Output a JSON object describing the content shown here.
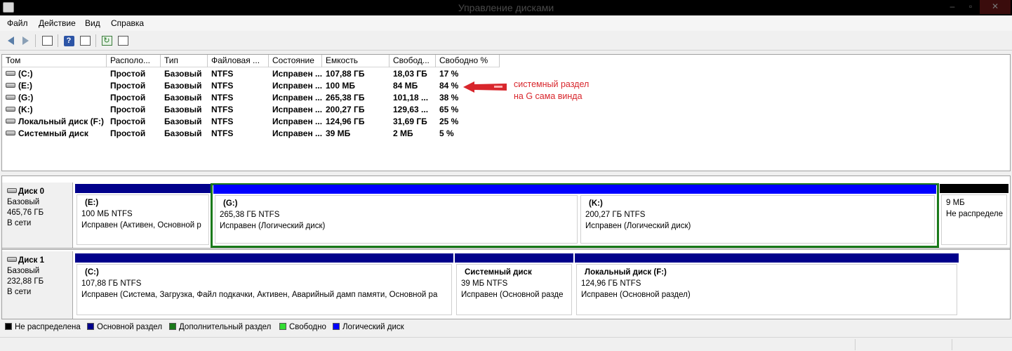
{
  "window": {
    "title": "Управление дисками",
    "btn_min": "–",
    "btn_max": "▫",
    "btn_close": "✕"
  },
  "menu": [
    "Файл",
    "Действие",
    "Вид",
    "Справка"
  ],
  "toolbar_icons": [
    "back-arrow-icon",
    "forward-arrow-icon",
    "console-tree-icon",
    "help-icon",
    "properties-icon",
    "refresh-icon",
    "settings-icon"
  ],
  "table": {
    "columns": [
      "Том",
      "Располо...",
      "Тип",
      "Файловая ...",
      "Состояние",
      "Емкость",
      "Свобод...",
      "Свободно %"
    ],
    "rows": [
      [
        "(C:)",
        "Простой",
        "Базовый",
        "NTFS",
        "Исправен ...",
        "107,88 ГБ",
        "18,03 ГБ",
        "17 %"
      ],
      [
        "(E:)",
        "Простой",
        "Базовый",
        "NTFS",
        "Исправен ...",
        "100 МБ",
        "84 МБ",
        "84 %"
      ],
      [
        "(G:)",
        "Простой",
        "Базовый",
        "NTFS",
        "Исправен ...",
        "265,38 ГБ",
        "101,18 ...",
        "38 %"
      ],
      [
        "(K:)",
        "Простой",
        "Базовый",
        "NTFS",
        "Исправен ...",
        "200,27 ГБ",
        "129,63 ...",
        "65 %"
      ],
      [
        "Локальный диск (F:)",
        "Простой",
        "Базовый",
        "NTFS",
        "Исправен ...",
        "124,96 ГБ",
        "31,69 ГБ",
        "25 %"
      ],
      [
        "Системный диск",
        "Простой",
        "Базовый",
        "NTFS",
        "Исправен ...",
        "39 МБ",
        "2 МБ",
        "5 %"
      ]
    ]
  },
  "annotation": {
    "line1": "системный раздел",
    "line2": "на G сама винда",
    "color": "#d8262c"
  },
  "disks": [
    {
      "name": "Диск 0",
      "type": "Базовый",
      "size": "465,76 ГБ",
      "state": "В сети",
      "partitions": [
        {
          "name": "(E:)",
          "size": "100 МБ NTFS",
          "status": "Исправен (Активен, Основной р",
          "kind": "primary"
        },
        {
          "name": "(G:)",
          "size": "265,38 ГБ NTFS",
          "status": "Исправен (Логический диск)",
          "kind": "logical"
        },
        {
          "name": "(K:)",
          "size": "200,27 ГБ NTFS",
          "status": "Исправен (Логический диск)",
          "kind": "logical"
        },
        {
          "name": "",
          "size": "9 МБ",
          "status": "Не распределе",
          "kind": "unallocated"
        }
      ]
    },
    {
      "name": "Диск 1",
      "type": "Базовый",
      "size": "232,88 ГБ",
      "state": "В сети",
      "partitions": [
        {
          "name": "(C:)",
          "size": "107,88 ГБ NTFS",
          "status": "Исправен (Система, Загрузка, Файл подкачки, Активен, Аварийный дамп памяти, Основной ра",
          "kind": "primary"
        },
        {
          "name": "Системный диск",
          "size": "39 МБ NTFS",
          "status": "Исправен (Основной разде",
          "kind": "primary"
        },
        {
          "name": "Локальный диск  (F:)",
          "size": "124,96 ГБ NTFS",
          "status": "Исправен (Основной раздел)",
          "kind": "primary"
        }
      ]
    }
  ],
  "legend": [
    {
      "label": "Не распределена",
      "color": "#000000"
    },
    {
      "label": "Основной раздел",
      "color": "#00008b"
    },
    {
      "label": "Дополнительный раздел",
      "color": "#1a7a1a"
    },
    {
      "label": "Свободно",
      "color": "#33dd33"
    },
    {
      "label": "Логический диск",
      "color": "#0000ff"
    }
  ],
  "colors": {
    "primary": "#00008b",
    "logical": "#0000ff",
    "unallocated": "#000000",
    "extended": "#1a7a1a"
  }
}
